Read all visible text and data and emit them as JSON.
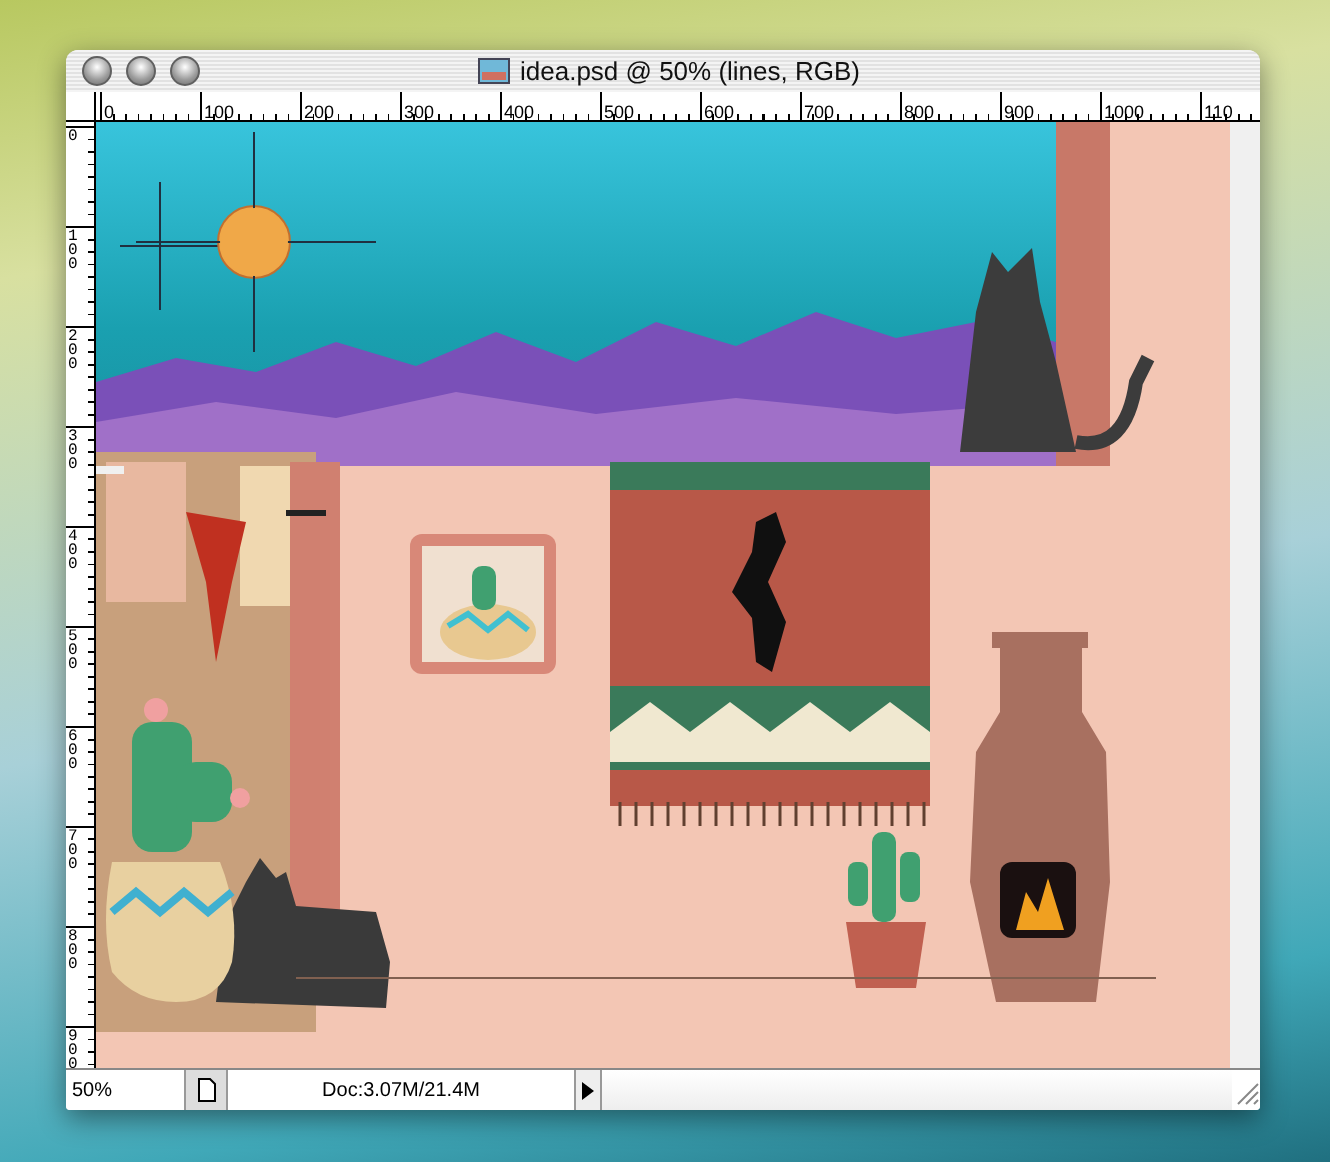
{
  "window": {
    "title": "idea.psd @ 50% (lines, RGB)"
  },
  "rulers": {
    "horizontal": [
      "0",
      "100",
      "200",
      "300",
      "400",
      "500",
      "600",
      "700",
      "800",
      "900",
      "1000",
      "110"
    ],
    "vertical": [
      "0",
      "100",
      "200",
      "300",
      "400",
      "500",
      "600",
      "700",
      "800",
      "900"
    ]
  },
  "status_bar": {
    "zoom": "50%",
    "doc_info": "Doc:3.07M/21.4M"
  }
}
